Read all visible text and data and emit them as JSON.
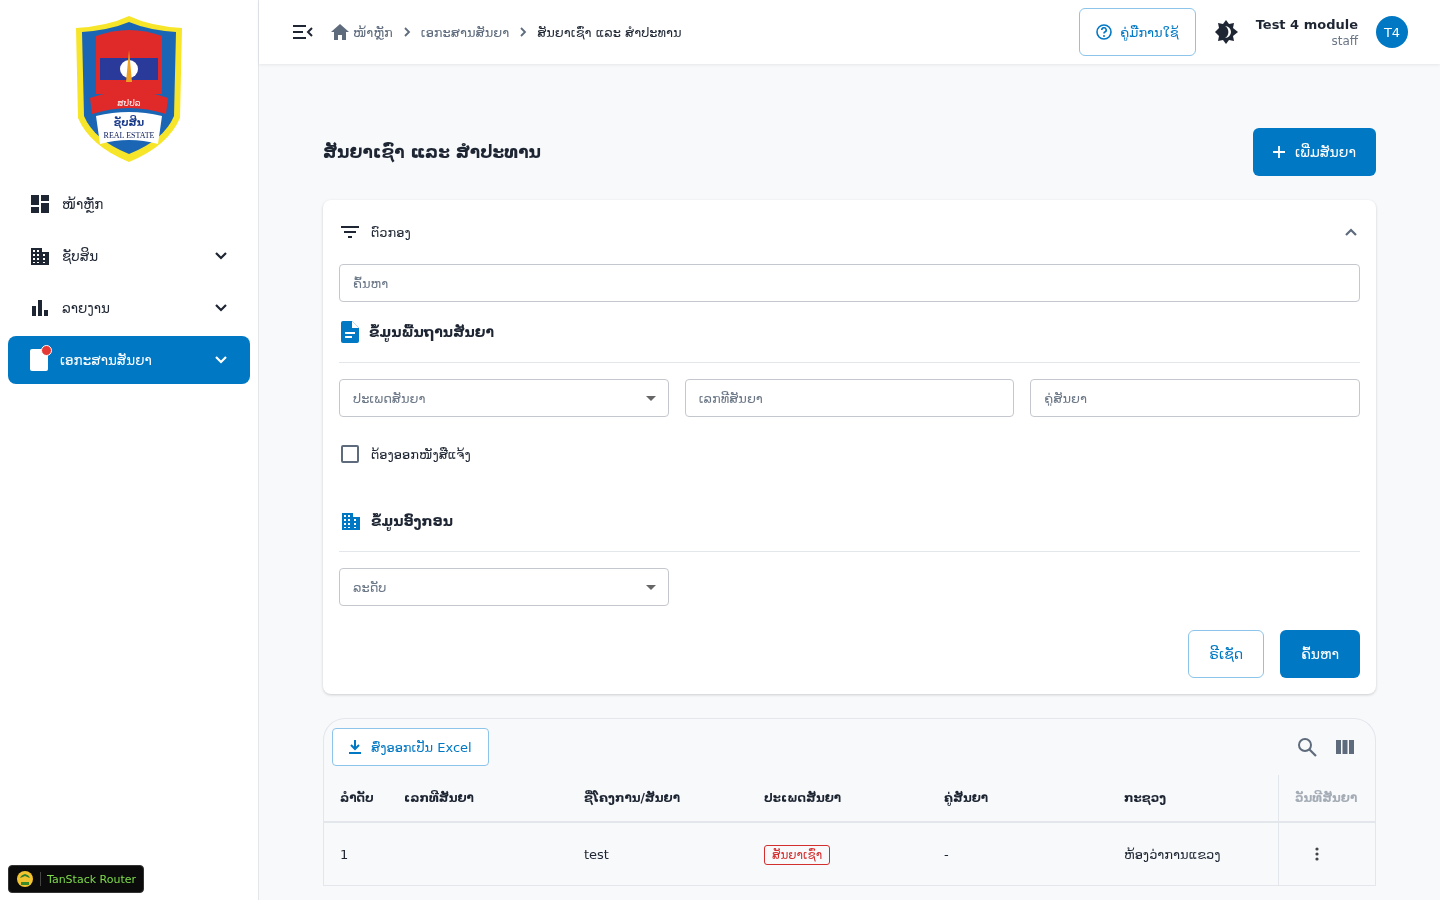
{
  "logo": {
    "texts": [
      "ສປປລ",
      "ຊັບສິນ",
      "REAL ESTATE"
    ]
  },
  "sidebar": {
    "items": [
      {
        "label": "ໜ້າຫຼັກ",
        "expandable": false,
        "selected": false,
        "badge": false
      },
      {
        "label": "ຊັບສິນ",
        "expandable": true,
        "selected": false,
        "badge": false
      },
      {
        "label": "ລາຍງານ",
        "expandable": true,
        "selected": false,
        "badge": false
      },
      {
        "label": "ເອກະສານສັນຍາ",
        "expandable": true,
        "selected": true,
        "badge": true
      }
    ]
  },
  "devtools": {
    "label": "TanStack Router"
  },
  "header": {
    "breadcrumbs": [
      "ໜ້າຫຼັກ",
      "ເອກະສານສັນຍາ",
      "ສັນຍາເຊົ່າ ແລະ ສຳປະທານ"
    ],
    "manual_button": "ຄູ່ມືການໃຊ້",
    "user": {
      "name": "Test 4 module",
      "role": "staff",
      "initials": "T4"
    }
  },
  "page": {
    "title": "ສັນຍາເຊົ່າ ແລະ ສຳປະທານ",
    "add_button": "ເພີ່ມສັນຍາ"
  },
  "filter": {
    "title": "ຕົວກອງ",
    "expanded": true,
    "search": {
      "placeholder": "ຄົ້ນຫາ"
    },
    "sections": [
      {
        "title": "ຂໍ້ມູນພື້ນຖານສັນຍາ",
        "fields": [
          {
            "kind": "select",
            "placeholder": "ປະເພດສັນຍາ"
          },
          {
            "kind": "text",
            "placeholder": "ເລກທີສັນຍາ"
          },
          {
            "kind": "text",
            "placeholder": "ຄູ່ສັນຍາ"
          }
        ],
        "checkbox": {
          "label": "ຕ້ອງອອກໜັງສືແຈ້ງ",
          "checked": false
        }
      },
      {
        "title": "ຂໍ້ມູນອົງກອນ",
        "fields": [
          {
            "kind": "select",
            "placeholder": "ລະດັບ"
          }
        ]
      }
    ],
    "reset_button": "ຣີເຊັດ",
    "search_button": "ຄົ້ນຫາ"
  },
  "table": {
    "export_button": "ສົ່ງອອກເປັນ Excel",
    "columns": [
      "ລຳດັບ",
      "ເລກທີສັນຍາ",
      "ຊື່ໂຄງການ/ສັນຍາ",
      "ປະເພດສັນຍາ",
      "ຄູ່ສັນຍາ",
      "ກະຊວງ",
      "ວັນທີສັນຍາ"
    ],
    "rows": [
      {
        "cells": [
          "1",
          "",
          "test",
          "ສັນຍາເຊົ່າ",
          "-",
          "ຫ້ອງວ່າການແຂວງ"
        ]
      }
    ]
  }
}
